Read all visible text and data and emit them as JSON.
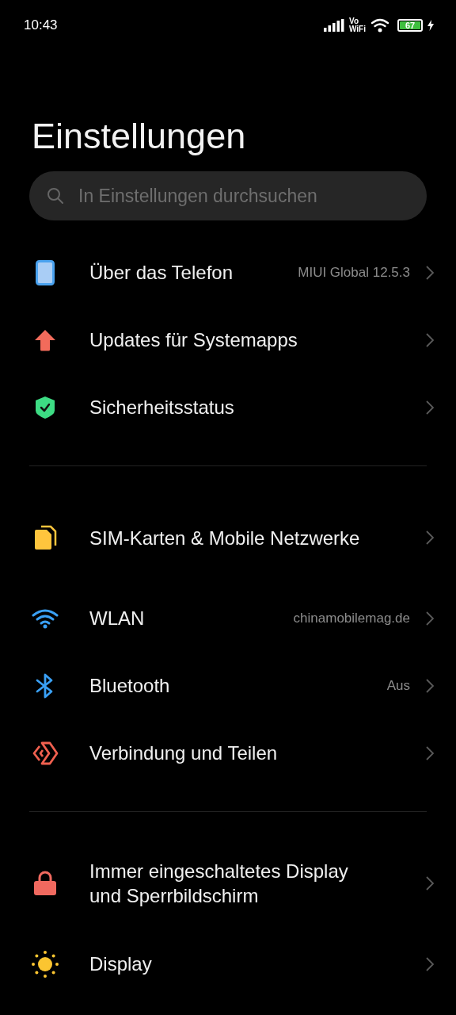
{
  "status_bar": {
    "time": "10:43",
    "volte_top": "Vo",
    "volte_bottom": "WiFi",
    "battery": "67"
  },
  "title": "Einstellungen",
  "search": {
    "placeholder": "In Einstellungen durchsuchen"
  },
  "sections": [
    {
      "items": [
        {
          "kind": "phone",
          "label": "Über das Telefon",
          "value": "MIUI Global 12.5.3"
        },
        {
          "kind": "update",
          "label": "Updates für Systemapps"
        },
        {
          "kind": "shield",
          "label": "Sicherheitsstatus"
        }
      ]
    },
    {
      "items": [
        {
          "kind": "sim",
          "label": "SIM-Karten & Mobile Netzwerke"
        },
        {
          "kind": "wifi",
          "label": "WLAN",
          "value": "chinamobilemag.de"
        },
        {
          "kind": "bluetooth",
          "label": "Bluetooth",
          "value": "Aus"
        },
        {
          "kind": "share",
          "label": "Verbindung und Teilen"
        }
      ]
    },
    {
      "items": [
        {
          "kind": "lock",
          "label": "Immer eingeschaltetes Display und Sperrbildschirm"
        },
        {
          "kind": "sun",
          "label": "Display"
        }
      ]
    }
  ]
}
